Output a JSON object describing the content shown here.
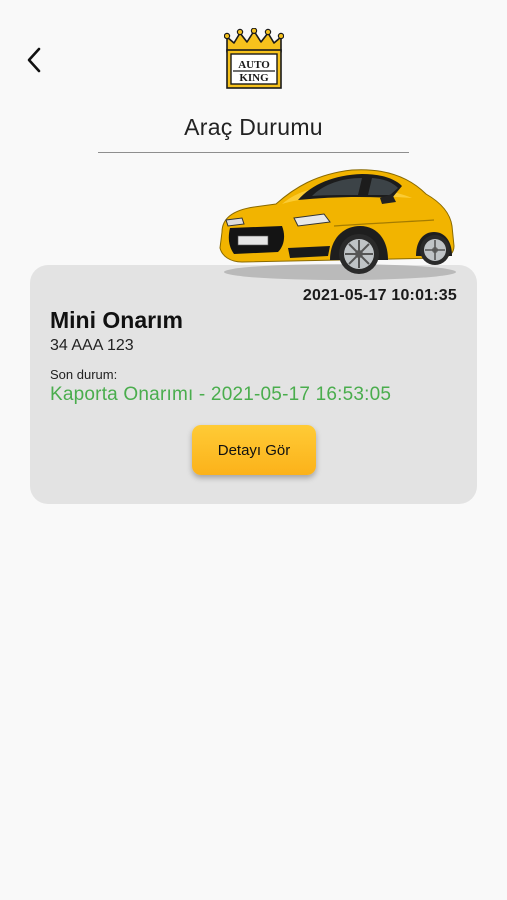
{
  "header": {
    "back_icon": "chevron-left-icon",
    "logo": {
      "line1": "AUTO",
      "line2": "KING",
      "colors": {
        "crown": "#f6c21c",
        "frame": "#1a1a1a"
      }
    },
    "title": "Araç Durumu"
  },
  "card": {
    "date": "2021-05-17 10:01:35",
    "service_title": "Mini Onarım",
    "plate": "34 AAA 123",
    "status_label": "Son durum:",
    "status_value": "Kaporta Onarımı - 2021-05-17 16:53:05",
    "status_color": "#4aad4d",
    "detail_button_label": "Detayı Gör",
    "car_image": "yellow-sports-car",
    "car_color": "#f2b400"
  }
}
